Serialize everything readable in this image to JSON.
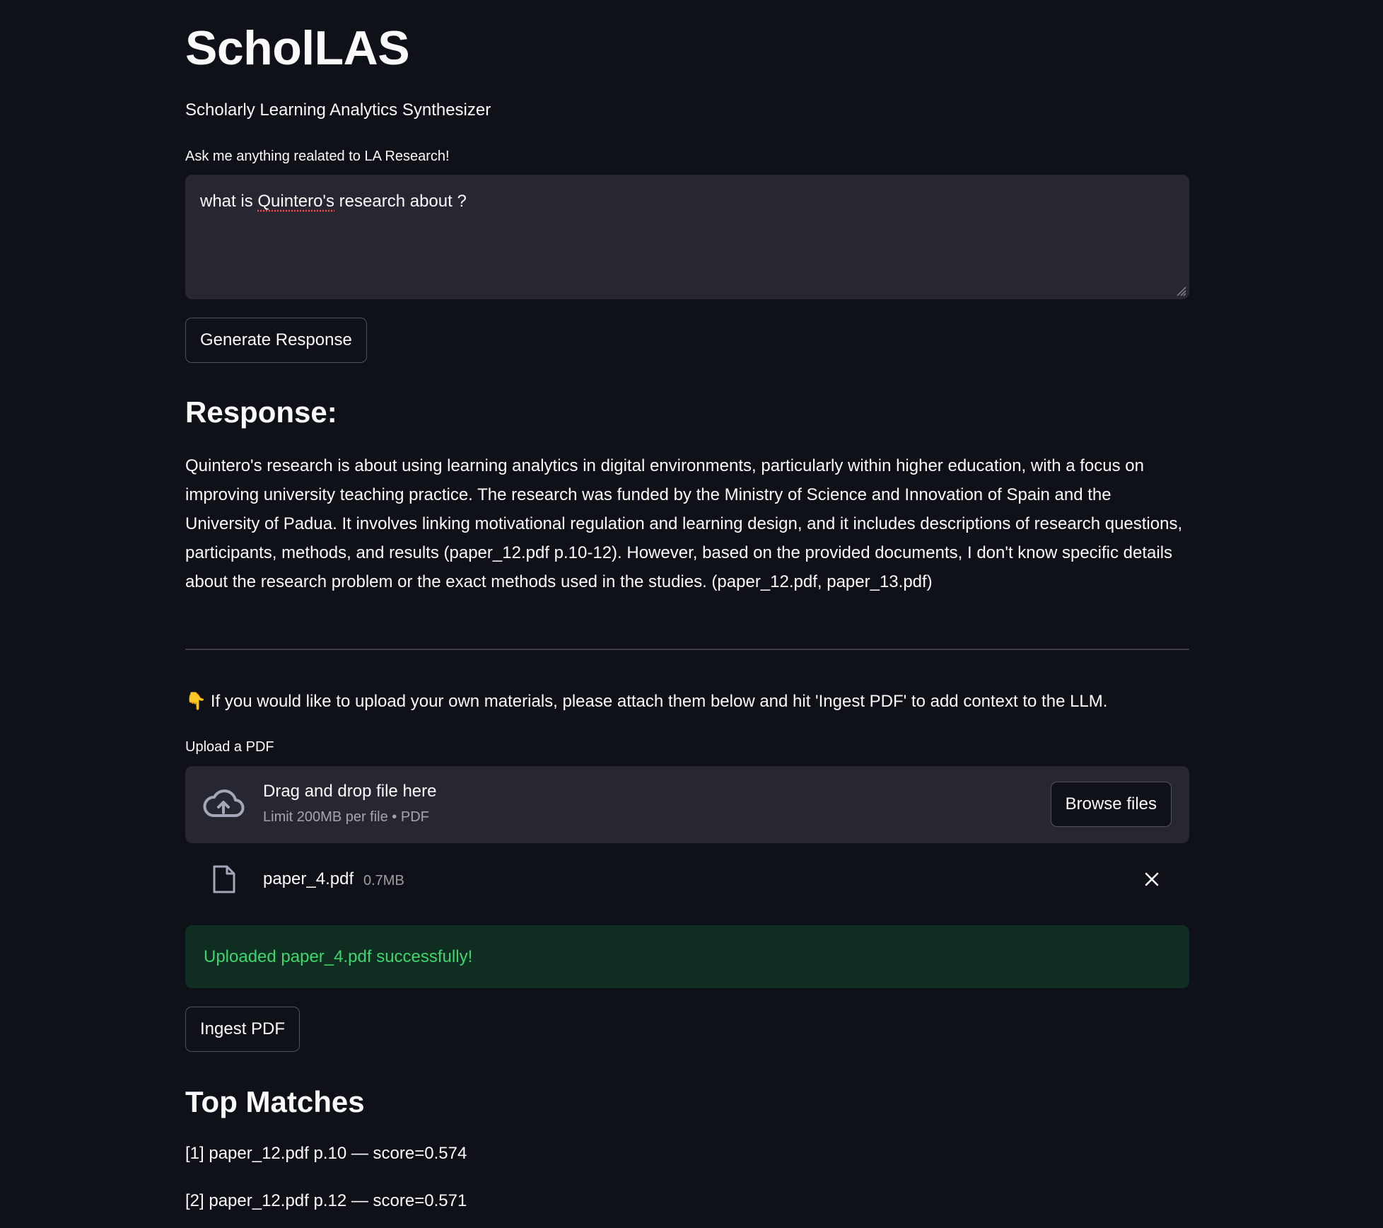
{
  "app": {
    "title": "ScholLAS",
    "subtitle": "Scholarly Learning Analytics Synthesizer"
  },
  "query": {
    "label": "Ask me anything realated to LA Research!",
    "value_prefix": "what is ",
    "value_misspelled": "Quintero's",
    "value_suffix": " research about ?"
  },
  "generate_button": {
    "label": "Generate Response"
  },
  "response": {
    "heading": "Response:",
    "text": "Quintero's research is about using learning analytics in digital environments, particularly within higher education, with a focus on improving university teaching practice. The research was funded by the Ministry of Science and Innovation of Spain and the University of Padua. It involves linking motivational regulation and learning design, and it includes descriptions of research questions, participants, methods, and results (paper_12.pdf p.10-12). However, based on the provided documents, I don't know specific details about the research problem or the exact methods used in the studies. (paper_12.pdf, paper_13.pdf)"
  },
  "upload": {
    "note_emoji": "👇",
    "note": "If you would like to upload your own materials, please attach them below and hit 'Ingest PDF' to add context to the LLM.",
    "label": "Upload a PDF",
    "dropzone_title": "Drag and drop file here",
    "dropzone_limit": "Limit 200MB per file • PDF",
    "browse_label": "Browse files",
    "file": {
      "name": "paper_4.pdf",
      "size": "0.7MB"
    },
    "success_message": "Uploaded paper_4.pdf successfully!"
  },
  "ingest_button": {
    "label": "Ingest PDF"
  },
  "matches": {
    "heading": "Top Matches",
    "items": [
      "[1] paper_12.pdf p.10 — score=0.574",
      "[2] paper_12.pdf p.12 — score=0.571"
    ]
  },
  "colors": {
    "background": "#0e1117",
    "input_background": "#262730",
    "success_text": "#3dd56d",
    "text": "#fafafa"
  }
}
